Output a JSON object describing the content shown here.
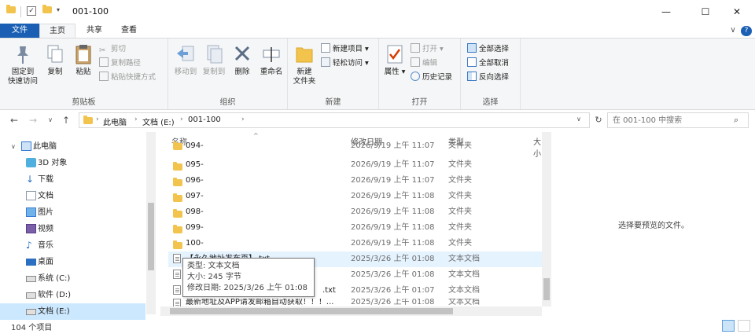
{
  "window": {
    "title": "001-100",
    "minimize": "—",
    "maximize": "☐",
    "close": "✕"
  },
  "tabs": {
    "file": "文件",
    "home": "主页",
    "share": "共享",
    "view": "查看"
  },
  "ribbon": {
    "clipboard": {
      "label": "剪贴板",
      "pin_line1": "固定到",
      "pin_line2": "快速访问",
      "copy": "复制",
      "paste": "粘贴",
      "cut": "剪切",
      "copy_path": "复制路径",
      "paste_shortcut": "粘贴快捷方式"
    },
    "organize": {
      "label": "组织",
      "move_to": "移动到",
      "copy_to": "复制到",
      "delete": "删除",
      "rename": "重命名"
    },
    "new": {
      "label": "新建",
      "new_folder_line1": "新建",
      "new_folder_line2": "文件夹",
      "new_item": "新建项目",
      "easy_access": "轻松访问"
    },
    "open": {
      "label": "打开",
      "properties": "属性",
      "open": "打开",
      "edit": "编辑",
      "history": "历史记录"
    },
    "select": {
      "label": "选择",
      "select_all": "全部选择",
      "select_none": "全部取消",
      "invert": "反向选择"
    }
  },
  "address": {
    "crumbs": [
      "此电脑",
      "文档 (E:)",
      "001-100"
    ],
    "search_placeholder": "在 001-100 中搜索"
  },
  "nav": {
    "items": [
      {
        "label": "此电脑"
      },
      {
        "label": "3D 对象"
      },
      {
        "label": "下载"
      },
      {
        "label": "文档"
      },
      {
        "label": "图片"
      },
      {
        "label": "视频"
      },
      {
        "label": "音乐"
      },
      {
        "label": "桌面"
      },
      {
        "label": "系统 (C:)"
      },
      {
        "label": "软件 (D:)"
      },
      {
        "label": "文档 (E:)"
      }
    ]
  },
  "list": {
    "columns": {
      "name": "名称",
      "date": "修改日期",
      "type": "类型",
      "size": "大小"
    },
    "rows": [
      {
        "name": "094-",
        "date": "2026/9/19 上午 11:07",
        "type": "文件夹"
      },
      {
        "name": "095-",
        "date": "2026/9/19 上午 11:07",
        "type": "文件夹"
      },
      {
        "name": "096-",
        "date": "2026/9/19 上午 11:07",
        "type": "文件夹"
      },
      {
        "name": "097-",
        "date": "2026/9/19 上午 11:08",
        "type": "文件夹"
      },
      {
        "name": "098-",
        "date": "2026/9/19 上午 11:08",
        "type": "文件夹"
      },
      {
        "name": "099-",
        "date": "2026/9/19 上午 11:08",
        "type": "文件夹"
      },
      {
        "name": "100-",
        "date": "2026/9/19 上午 11:08",
        "type": "文件夹"
      },
      {
        "name": "【永久地址发布页】.txt",
        "date": "2025/3/26 上午 01:08",
        "type": "文本文档"
      },
      {
        "name": "",
        "date": "2025/3/26 上午 01:08",
        "type": "文本文档"
      },
      {
        "name": ".txt",
        "date": "2025/3/26 上午 01:07",
        "type": "文本文档"
      },
      {
        "name": "最新地址及APP请发邮箱自动获取！！！...",
        "date": "2025/3/26 上午 01:08",
        "type": "文本文档"
      }
    ]
  },
  "tooltip": {
    "type_line": "类型: 文本文档",
    "size_line": "大小: 245 字节",
    "date_line": "修改日期: 2025/3/26 上午 01:08"
  },
  "preview": {
    "message": "选择要预览的文件。"
  },
  "status": {
    "count": "104 个项目"
  }
}
